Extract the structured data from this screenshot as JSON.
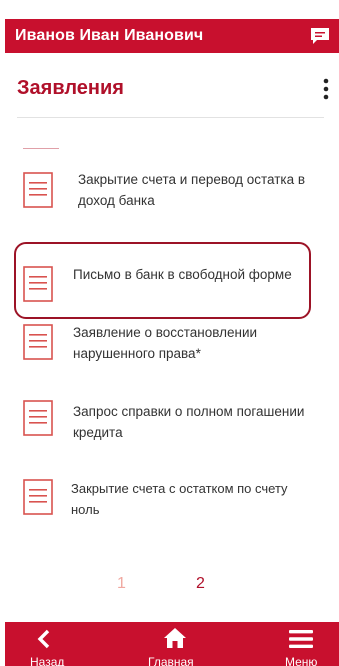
{
  "app": {
    "user_name": "Иванов Иван Иванович"
  },
  "header": {
    "title": "Заявления"
  },
  "documents": [
    {
      "label_line1": "Закрытие счета и перевод остатка в",
      "label_line2": "доход банка"
    },
    {
      "label_line1": "Письмо в банк в свободной форме",
      "label_line2": ""
    },
    {
      "label_line1": "Заявление о восстановлении",
      "label_line2": "нарушенного права*"
    },
    {
      "label_line1": "Запрос справки о полном погашении",
      "label_line2": "кредита"
    },
    {
      "label_line1": "Закрытие счета с остатком по счету",
      "label_line2": "ноль"
    }
  ],
  "pager": {
    "page1": "1",
    "page2": "2",
    "current": "2"
  },
  "bottom_nav": {
    "back_label": "Назад",
    "home_label": "Главная",
    "menu_label": "Меню"
  },
  "colors": {
    "brand_red": "#c8102e",
    "title_red": "#b0102a",
    "inactive_page": "#f0a8a0",
    "active_page": "#b0102a"
  },
  "icons": {
    "chat": "chat-icon",
    "more": "more-vertical-icon",
    "document": "document-icon",
    "back": "back-arrow-icon",
    "home": "home-icon",
    "menu": "hamburger-menu-icon"
  }
}
